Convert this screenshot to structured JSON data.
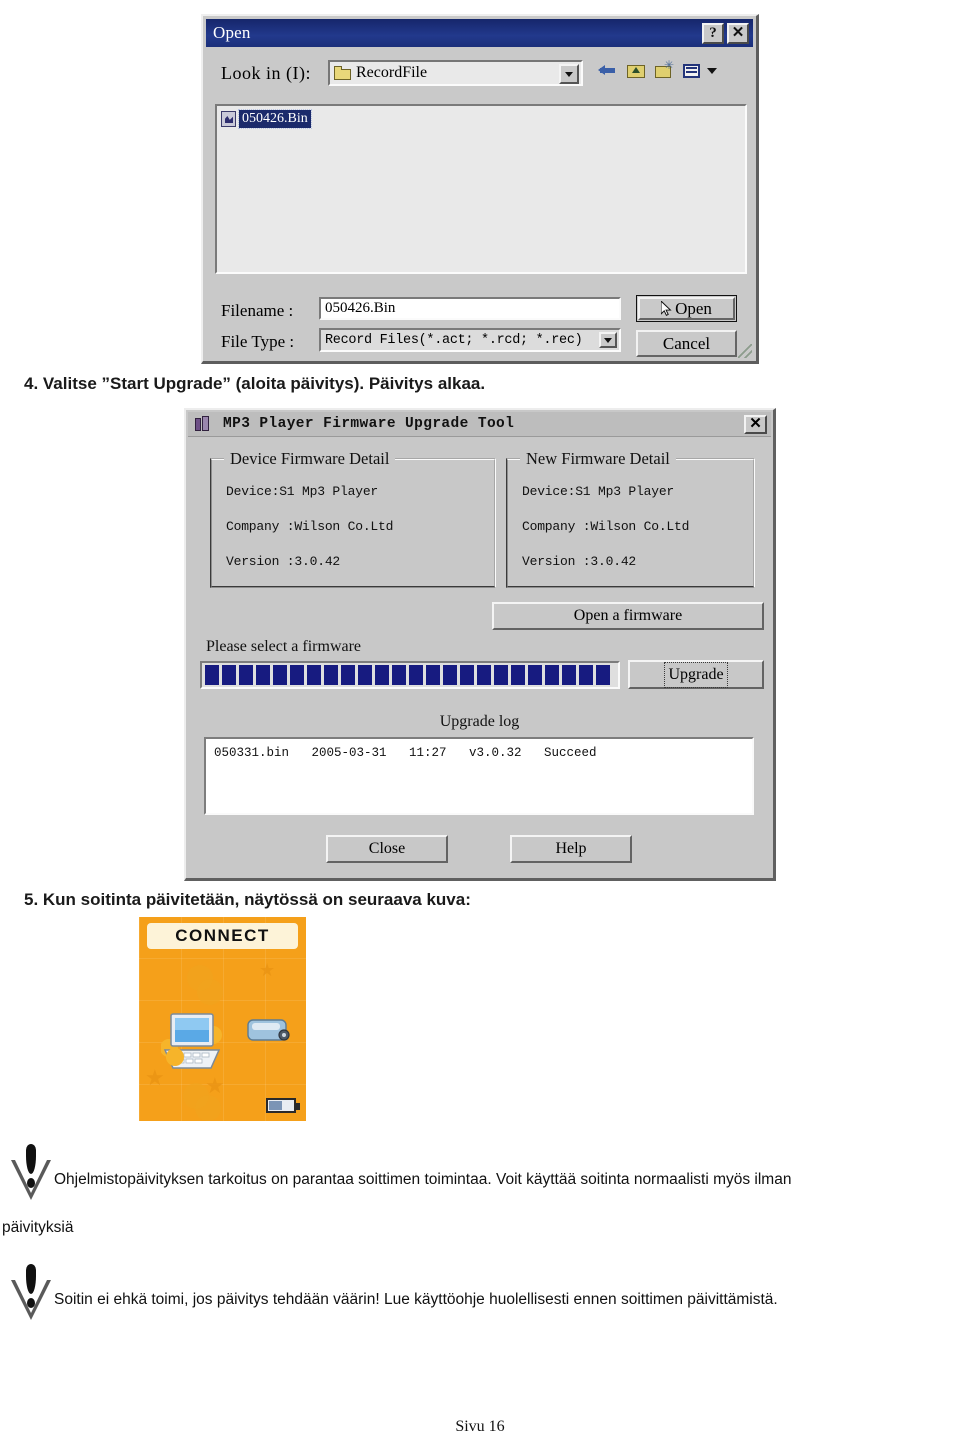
{
  "open_dialog": {
    "title": "Open",
    "help_button": "?",
    "close_button": "✕",
    "lookin_label": "Look in (I):",
    "lookin_value": "RecordFile",
    "toolbar_icons": [
      "back-icon",
      "up-one-level-icon",
      "new-folder-icon",
      "view-menu-icon"
    ],
    "file_list": [
      {
        "name": "050426.Bin",
        "icon": "bin-file-icon",
        "selected": true
      }
    ],
    "filename_label": "Filename :",
    "filename_value": "050426.Bin",
    "filetype_label": "File Type :",
    "filetype_value": "Record Files(*.act; *.rcd; *.rec)",
    "open_button": "Open",
    "cancel_button": "Cancel"
  },
  "step4": {
    "text": "4. Valitse ”Start Upgrade” (aloita päivitys). Päivitys alkaa."
  },
  "firmware_tool": {
    "title": "MP3 Player Firmware Upgrade Tool",
    "close_button": "✕",
    "device_group": {
      "legend": "Device Firmware Detail",
      "device": "Device:S1 Mp3 Player",
      "company": "Company :Wilson Co.Ltd",
      "version": "Version :3.0.42"
    },
    "new_group": {
      "legend": "New Firmware Detail",
      "device": "Device:S1 Mp3 Player",
      "company": "Company :Wilson Co.Ltd",
      "version": "Version :3.0.42"
    },
    "open_firmware_button": "Open a firmware",
    "status_text": "Please select a firmware",
    "progress": {
      "percent": 100,
      "segments": 24,
      "color": "#171b80"
    },
    "upgrade_button": "Upgrade",
    "upgrade_log_title": "Upgrade log",
    "log_entries": [
      "050331.bin   2005-03-31   11:27   v3.0.32   Succeed"
    ],
    "close_button_label": "Close",
    "help_button_label": "Help"
  },
  "step5": {
    "text": "5. Kun soitinta päivitetään, näytössä on seuraava kuva:"
  },
  "connect_screen": {
    "banner": "CONNECT",
    "background_color": "#f5a01a",
    "icons": [
      "laptop-icon",
      "mp3-player-icon",
      "battery-icon"
    ]
  },
  "notes": [
    {
      "icon": "warning-icon",
      "text": "Ohjelmistopäivityksen tarkoitus on parantaa soittimen toimintaa. Voit käyttää soitinta normaalisti myös ilman",
      "continuation": "päivityksiä"
    },
    {
      "icon": "warning-icon",
      "text": "Soitin ei ehkä toimi, jos päivitys tehdään väärin! Lue käyttöohje huolellisesti ennen soittimen päivittämistä."
    }
  ],
  "footer": {
    "page_label": "Sivu 16"
  }
}
